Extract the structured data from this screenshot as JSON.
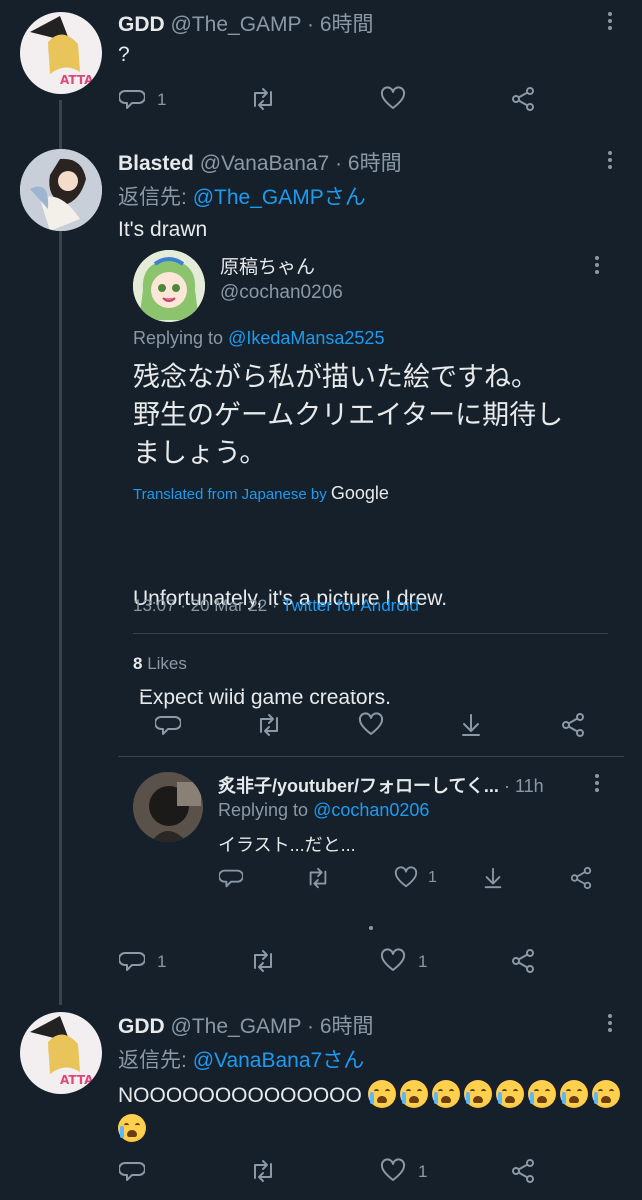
{
  "tweet1": {
    "name": "GDD",
    "handle": "@The_GAMP · 6時間",
    "text": "?",
    "reply_count": "1"
  },
  "tweet2": {
    "name": "Blasted",
    "handle": "@VanaBana7 · 6時間",
    "reply_prefix": "返信先:",
    "reply_to": "@The_GAMPさん",
    "text": "It's drawn",
    "reply_count": "1",
    "like_count": "1"
  },
  "quoted": {
    "name": "原稿ちゃん",
    "handle": "@cochan0206",
    "replying_prefix": "Replying to",
    "replying_to": "@IkedaMansa2525",
    "text_line1": "残念ながら私が描いた絵ですね。",
    "text_line2": "野生のゲームクリエイターに期待し",
    "text_line3": "ましょう。",
    "translated_label": "Translated from Japanese by",
    "translated_brand": "Google",
    "translation_line1": "Unfortunately, it's a picture I drew.",
    "translation_line2": " Expect wild game creators.",
    "timestamp": "13:07 · 20 Mar 22 · ",
    "source": "Twitter for Android",
    "likes_count": "8",
    "likes_label": "Likes"
  },
  "nested_reply": {
    "name": "炙非子/youtuber/フォローしてく...",
    "time": "· 11h",
    "replying_prefix": "Replying to",
    "replying_to": "@cochan0206",
    "text": "イラスト...だと...",
    "like_count": "1"
  },
  "tweet3": {
    "name": "GDD",
    "handle": "@The_GAMP · 6時間",
    "reply_prefix": "返信先:",
    "reply_to": "@VanaBana7さん",
    "text": "NOOOOOOOOOOOOOO",
    "like_count": "1"
  },
  "colors": {
    "background": "#15202b",
    "link": "#1d9bf0",
    "muted": "#8b98a5",
    "text": "#e7e9ea"
  },
  "icons": [
    "reply-icon",
    "retweet-icon",
    "like-icon",
    "share-icon",
    "more-icon",
    "bookmark-down-icon",
    "crying-face-emoji"
  ]
}
